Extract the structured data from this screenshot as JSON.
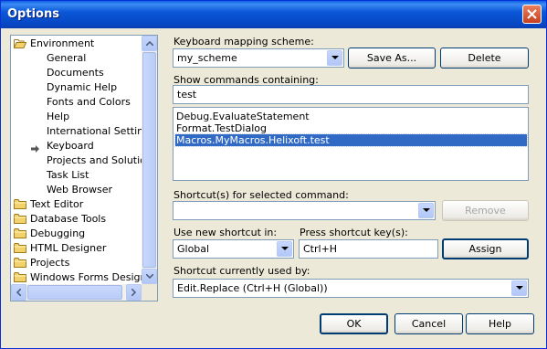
{
  "window": {
    "title": "Options"
  },
  "tree": {
    "nodes": [
      {
        "label": "Environment",
        "level": 0
      },
      {
        "label": "General",
        "level": 1
      },
      {
        "label": "Documents",
        "level": 1
      },
      {
        "label": "Dynamic Help",
        "level": 1
      },
      {
        "label": "Fonts and Colors",
        "level": 1
      },
      {
        "label": "Help",
        "level": 1
      },
      {
        "label": "International Settings",
        "level": 1
      },
      {
        "label": "Keyboard",
        "level": 1,
        "selected": true
      },
      {
        "label": "Projects and Solutions",
        "level": 1
      },
      {
        "label": "Task List",
        "level": 1
      },
      {
        "label": "Web Browser",
        "level": 1
      },
      {
        "label": "Text Editor",
        "level": 0
      },
      {
        "label": "Database Tools",
        "level": 0
      },
      {
        "label": "Debugging",
        "level": 0
      },
      {
        "label": "HTML Designer",
        "level": 0
      },
      {
        "label": "Projects",
        "level": 0
      },
      {
        "label": "Windows Forms Designer",
        "level": 0
      }
    ]
  },
  "mapping": {
    "label": "Keyboard mapping scheme:",
    "value": "my_scheme",
    "save_as": "Save As...",
    "delete": "Delete"
  },
  "commands": {
    "label": "Show commands containing:",
    "filter": "test",
    "items": [
      "Debug.EvaluateStatement",
      "Format.TestDialog",
      "Macros.MyMacros.Helixoft.test"
    ],
    "selected_index": 2
  },
  "shortcuts": {
    "label": "Shortcut(s) for selected command:",
    "value": "",
    "remove": "Remove"
  },
  "newshortcut": {
    "use_in_label": "Use new shortcut in:",
    "use_in_value": "Global",
    "press_label": "Press shortcut key(s):",
    "press_value": "Ctrl+H",
    "assign": "Assign"
  },
  "currently": {
    "label": "Shortcut currently used by:",
    "value": "Edit.Replace (Ctrl+H (Global))"
  },
  "footer": {
    "ok": "OK",
    "cancel": "Cancel",
    "help": "Help"
  },
  "colors": {
    "titlebar": "#0a57d8",
    "selection": "#316ac5",
    "dialog": "#ece9d8"
  }
}
